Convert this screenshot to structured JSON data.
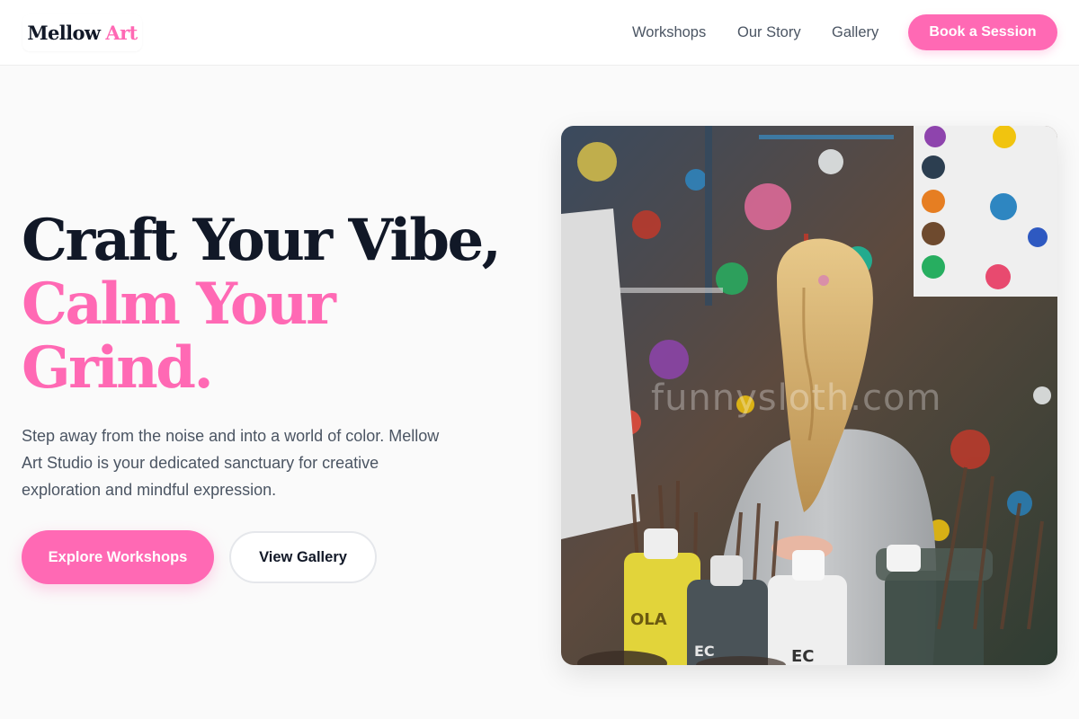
{
  "header": {
    "logo": {
      "part1": "Mellow",
      "part2": "Art"
    },
    "nav": [
      {
        "label": "Workshops"
      },
      {
        "label": "Our Story"
      },
      {
        "label": "Gallery"
      }
    ],
    "cta_label": "Book a Session"
  },
  "hero": {
    "title_line1": "Craft Your Vibe,",
    "title_line2": "Calm Your",
    "title_line3": "Grind.",
    "description": "Step away from the noise and into a world of color. Mellow Art Studio is your dedicated sanctuary for creative exploration and mindful expression.",
    "primary_button": "Explore Workshops",
    "secondary_button": "View Gallery",
    "image": {
      "watermark": "funnysloth.com",
      "subject": "child with blonde ponytail in grey top facing a paint-splattered wall, paint bottles and brush jars in foreground",
      "bottle_labels": [
        "OLA",
        "EC",
        "EC"
      ]
    }
  },
  "colors": {
    "accent": "#ff69b4",
    "heading": "#111827",
    "body_text": "#4b5563",
    "page_background": "#fafafa"
  }
}
